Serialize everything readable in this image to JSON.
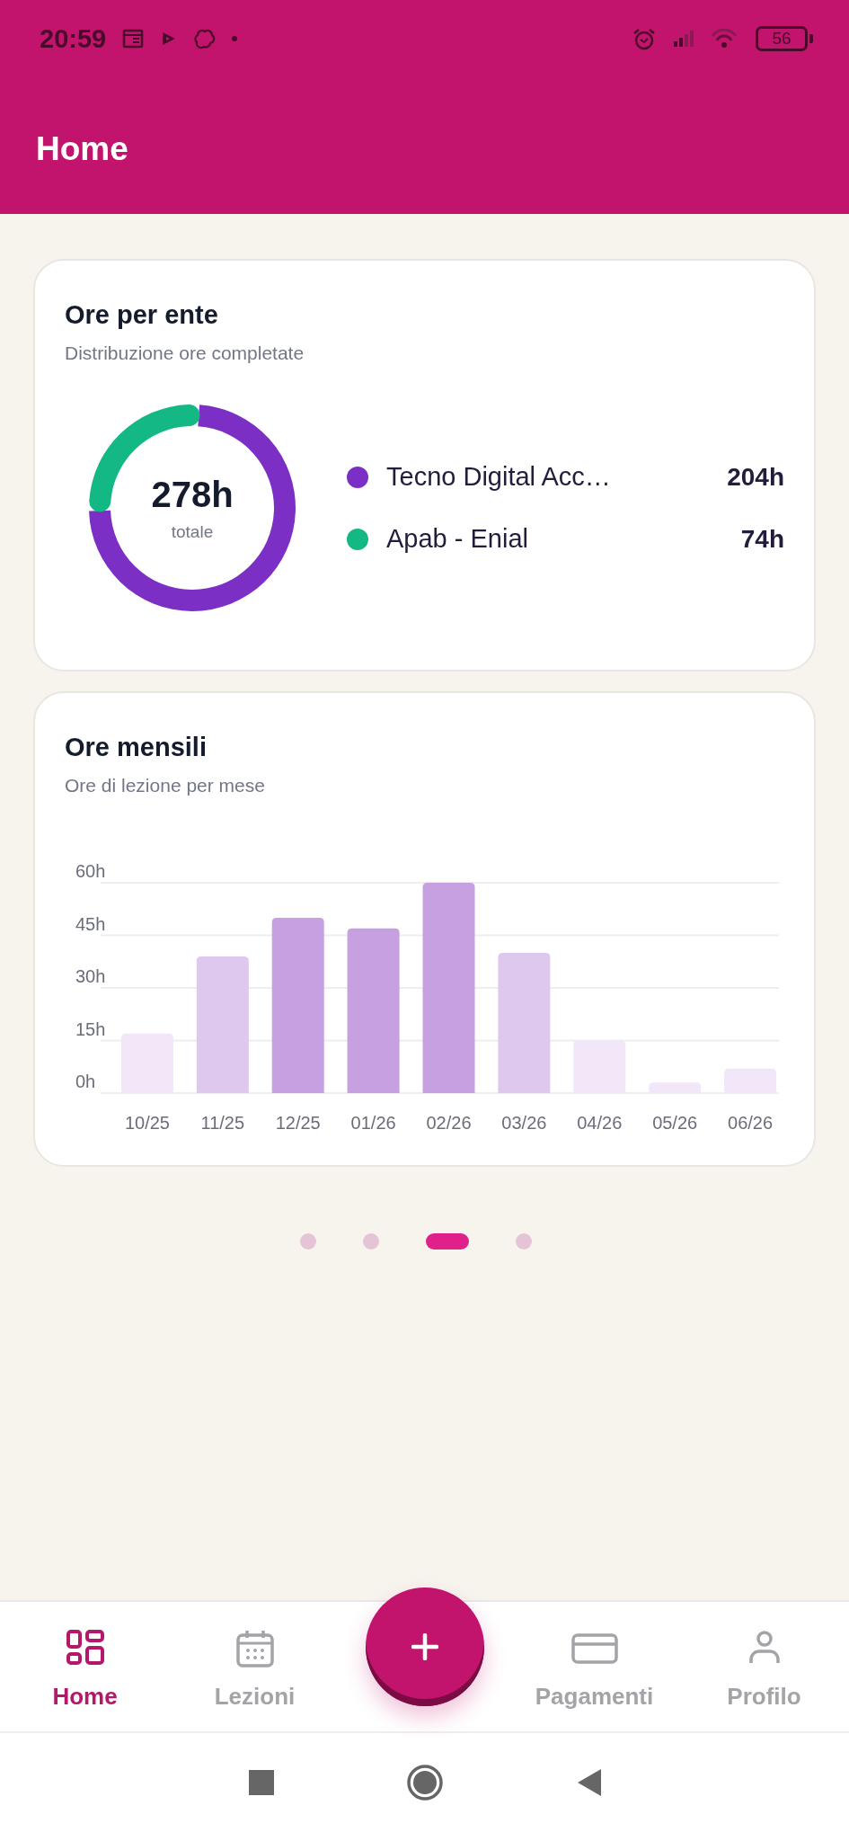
{
  "status_bar": {
    "time": "20:59",
    "battery": "56"
  },
  "app_bar": {
    "title": "Home"
  },
  "cards": [
    {
      "title": "Ore per ente",
      "subtitle": "Distribuzione ore completate",
      "total": "278h",
      "total_label": "totale",
      "chart_data": {
        "type": "donut",
        "categories": [
          "Tecno Digital Acc…",
          "Apab - Enial"
        ],
        "values": [
          73.4,
          26.6
        ]
      },
      "legend": [
        {
          "value": "204h",
          "color": "#7b2fc4"
        },
        {
          "value": "74h",
          "color": "#14b885"
        }
      ]
    },
    {
      "title": "Ore mensili",
      "subtitle": "Ore di lezione per mese",
      "chart_data": {
        "type": "bar",
        "categories": [
          "10/25",
          "11/25",
          "12/25",
          "01/26",
          "02/26",
          "03/26",
          "04/26",
          "05/26",
          "06/26"
        ],
        "values": [
          17,
          39,
          50,
          47,
          60,
          40,
          15,
          3,
          7
        ],
        "ylim": [
          0,
          60
        ],
        "yticks": [
          {
            "value": 0,
            "label": "0h"
          },
          {
            "value": 15,
            "label": "15h"
          },
          {
            "value": 30,
            "label": "30h"
          },
          {
            "value": 45,
            "label": "45h"
          },
          {
            "value": 60,
            "label": "60h"
          }
        ],
        "grid": true
      },
      "bars": [
        {
          "color": "#f1e7f8"
        },
        {
          "color": "#dfc8ee"
        },
        {
          "color": "#c7a0e2"
        },
        {
          "color": "#c7a0e2"
        },
        {
          "color": "#c7a0e2"
        },
        {
          "color": "#dfc8ee"
        },
        {
          "color": "#f1e7f8"
        },
        {
          "color": "#f1e7f8"
        },
        {
          "color": "#f1e7f8"
        }
      ]
    }
  ],
  "pager": [
    {
      "selected": false
    },
    {
      "selected": false
    },
    {
      "selected": true
    },
    {
      "selected": false
    }
  ],
  "bottom_nav": [
    {
      "kind": "tab",
      "label": "Home",
      "selected": true
    },
    {
      "kind": "tab",
      "label": "Lezioni",
      "selected": false
    },
    {
      "kind": "fab"
    },
    {
      "kind": "tab",
      "label": "Pagamenti",
      "selected": false
    },
    {
      "kind": "tab",
      "label": "Profilo",
      "selected": false
    }
  ]
}
